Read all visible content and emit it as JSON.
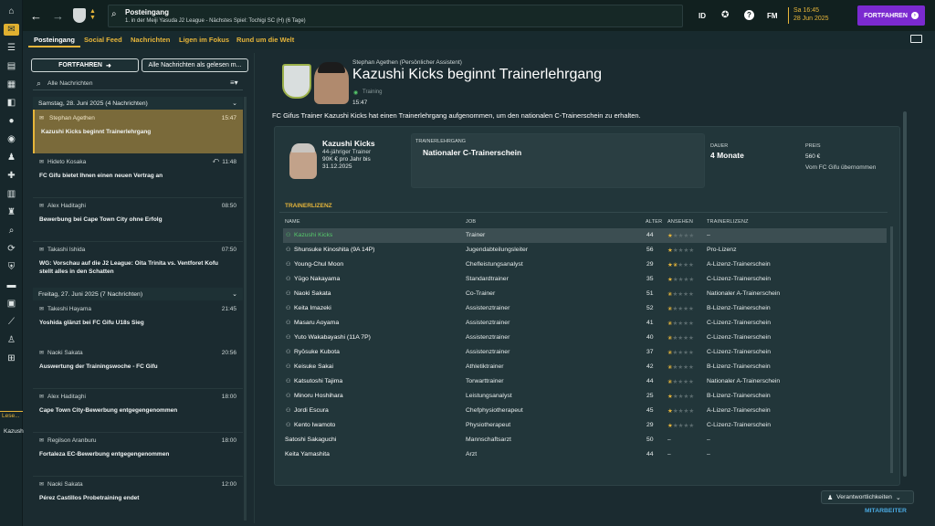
{
  "topbar": {
    "title": "Posteingang",
    "subtitle": "1. in der Meiji Yasuda J2 League - Nächstes Spiel: Tochigi SC (H) (6 Tage)",
    "id_label": "ID",
    "fm_label": "FM",
    "date_day": "Sa 16:45",
    "date": "28 Jun 2025",
    "continue_label": "FORTFAHREN"
  },
  "tabs": [
    "Posteingang",
    "Social Feed",
    "Nachrichten",
    "Ligen im Fokus",
    "Rund um die Welt"
  ],
  "sidebar_bottom": {
    "label": "Lese...",
    "name": "Kazush"
  },
  "list": {
    "continue_label": "FORTFAHREN",
    "mark_read_label": "Alle Nachrichten als gelesen m...",
    "search_placeholder": "Alle Nachrichten",
    "groups": [
      {
        "label": "Samstag, 28. Juni 2025 (4 Nachrichten)"
      },
      {
        "label": "Freitag, 27. Juni 2025 (7 Nachrichten)"
      }
    ],
    "messages": [
      {
        "from": "Stephan Agethen",
        "time": "15:47",
        "subject": "Kazushi Kicks beginnt Trainerlehrgang"
      },
      {
        "from": "Hideto Kosaka",
        "time": "11:48",
        "subject": "FC Gifu bietet Ihnen einen neuen Vertrag an"
      },
      {
        "from": "Alex Haditaghi",
        "time": "08:50",
        "subject": "Bewerbung bei Cape Town City ohne Erfolg"
      },
      {
        "from": "Takashi Ishida",
        "time": "07:50",
        "subject": "WG: Vorschau auf die J2 League: Oita Trinita vs. Ventforet Kofu stellt alles in den Schatten"
      },
      {
        "from": "Takeshi Hayama",
        "time": "21:45",
        "subject": "Yoshida glänzt bei FC Gifu U18s Sieg"
      },
      {
        "from": "Naoki Sakata",
        "time": "20:56",
        "subject": "Auswertung der Trainingswoche - FC Gifu"
      },
      {
        "from": "Alex Haditaghi",
        "time": "18:00",
        "subject": "Cape Town City-Bewerbung entgegengenommen"
      },
      {
        "from": "Regilson Aranburu",
        "time": "18:00",
        "subject": "Fortaleza EC-Bewerbung entgegengenommen"
      },
      {
        "from": "Naoki Sakata",
        "time": "12:00",
        "subject": "Pérez Castillos Probetraining endet"
      }
    ]
  },
  "detail": {
    "sender": "Stephan Agethen (Persönlicher Assistent)",
    "headline": "Kazushi Kicks beginnt Trainerlehrgang",
    "category": "Training",
    "time": "15:47",
    "body": "FC Gifus Trainer Kazushi Kicks hat einen Trainerlehrgang aufgenommen, um den nationalen C-Trainerschein zu erhalten.",
    "person_name": "Kazushi Kicks",
    "person_role": "44-jähriger Trainer",
    "person_contract": "90K € pro Jahr bis 31.12.2025",
    "course_label": "TRAINERLEHRGANG",
    "course_value": "Nationaler C-Trainerschein",
    "duration_label": "DAUER",
    "duration_value": "4 Monate",
    "price_label": "PREIS",
    "price_value": "560 €",
    "price_note": "Vom FC Gifu übernommen",
    "table_title": "TRAINERLIZENZ",
    "columns": [
      "NAME",
      "JOB",
      "ALTER",
      "ANSEHEN",
      "TRAINERLIZENZ"
    ],
    "rows": [
      {
        "name": "Kazushi Kicks",
        "job": "Trainer",
        "age": "44",
        "stars": 1,
        "license": "–"
      },
      {
        "name": "Shunsuke Kinoshita (9A 14P)",
        "job": "Jugendabteilungsleiter",
        "age": "56",
        "stars": 1,
        "license": "Pro-Lizenz"
      },
      {
        "name": "Young-Chul Moon",
        "job": "Chefleistungsanalyst",
        "age": "29",
        "stars": 1.5,
        "license": "A-Lizenz-Trainerschein"
      },
      {
        "name": "Yūgo Nakayama",
        "job": "Standardtrainer",
        "age": "35",
        "stars": 1,
        "license": "C-Lizenz-Trainerschein"
      },
      {
        "name": "Naoki Sakata",
        "job": "Co-Trainer",
        "age": "51",
        "stars": 0.5,
        "license": "Nationaler A-Trainerschein"
      },
      {
        "name": "Keita Imazeki",
        "job": "Assistenztrainer",
        "age": "52",
        "stars": 0.5,
        "license": "B-Lizenz-Trainerschein"
      },
      {
        "name": "Masaru Aoyama",
        "job": "Assistenztrainer",
        "age": "41",
        "stars": 0.5,
        "license": "C-Lizenz-Trainerschein"
      },
      {
        "name": "Yuto Wakabayashi (11A 7P)",
        "job": "Assistenztrainer",
        "age": "40",
        "stars": 0.5,
        "license": "C-Lizenz-Trainerschein"
      },
      {
        "name": "Ryōsuke Kubota",
        "job": "Assistenztrainer",
        "age": "37",
        "stars": 0.5,
        "license": "C-Lizenz-Trainerschein"
      },
      {
        "name": "Keisuke Sakai",
        "job": "Athletiktrainer",
        "age": "42",
        "stars": 0.5,
        "license": "B-Lizenz-Trainerschein"
      },
      {
        "name": "Katsutoshi Tajima",
        "job": "Torwarttrainer",
        "age": "44",
        "stars": 0.5,
        "license": "Nationaler A-Trainerschein"
      },
      {
        "name": "Minoru Hoshihara",
        "job": "Leistungsanalyst",
        "age": "25",
        "stars": 1,
        "license": "B-Lizenz-Trainerschein"
      },
      {
        "name": "Jordi Escura",
        "job": "Chefphysiotherapeut",
        "age": "45",
        "stars": 1,
        "license": "A-Lizenz-Trainerschein"
      },
      {
        "name": "Kento Iwamoto",
        "job": "Physiotherapeut",
        "age": "29",
        "stars": 1,
        "license": "C-Lizenz-Trainerschein"
      },
      {
        "name": "Satoshi Sakaguchi",
        "job": "Mannschaftsarzt",
        "age": "50",
        "stars": null,
        "license": "–"
      },
      {
        "name": "Keita Yamashita",
        "job": "Arzt",
        "age": "44",
        "stars": null,
        "license": "–"
      }
    ],
    "responsibilities_label": "Verantwortlichkeiten",
    "staff_link": "MITARBEITER"
  },
  "colors": {
    "accent": "#e6b53a",
    "purple": "#7b2ad0",
    "highlight_green": "#56c96b"
  }
}
